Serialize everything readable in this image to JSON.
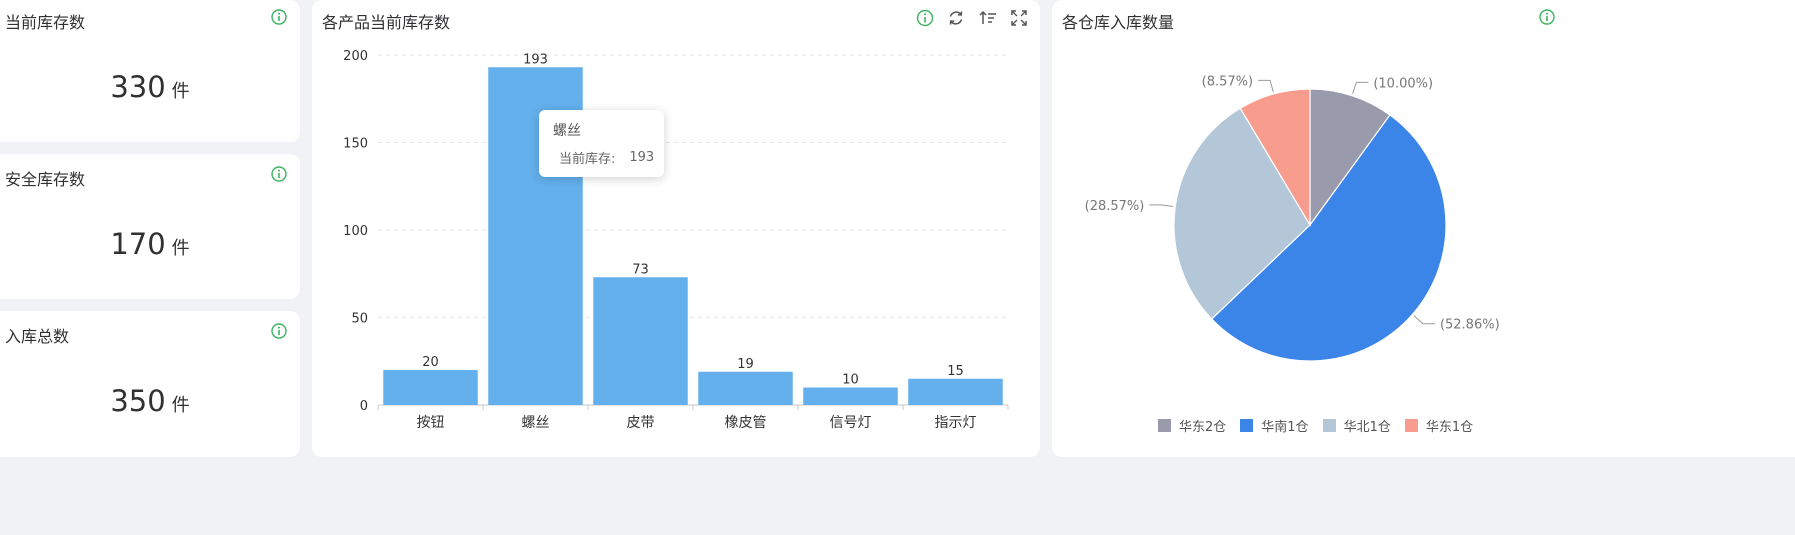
{
  "stats": [
    {
      "title": "当前库存数",
      "value": "330",
      "unit": "件"
    },
    {
      "title": "安全库存数",
      "value": "170",
      "unit": "件"
    },
    {
      "title": "入库总数",
      "value": "350",
      "unit": "件"
    }
  ],
  "bar_panel": {
    "title": "各产品当前库存数",
    "tooltip": {
      "category": "螺丝",
      "series_label": "当前库存:",
      "value": "193"
    }
  },
  "pie_panel": {
    "title": "各仓库入库数量"
  },
  "colors": {
    "bar": "#63b0ed",
    "info_icon": "#3cb35f",
    "pie": [
      "#9a9aad",
      "#3b84e8",
      "#b4c7d8",
      "#f89d8e"
    ]
  },
  "chart_data": [
    {
      "type": "bar",
      "title": "各产品当前库存数",
      "categories": [
        "按钮",
        "螺丝",
        "皮带",
        "橡皮管",
        "信号灯",
        "指示灯"
      ],
      "series": [
        {
          "name": "当前库存",
          "values": [
            20,
            193,
            73,
            19,
            10,
            15
          ]
        }
      ],
      "yticks": [
        "0",
        "50",
        "100",
        "150",
        "200"
      ],
      "ylim": [
        0,
        200
      ],
      "grid": true
    },
    {
      "type": "pie",
      "title": "各仓库入库数量",
      "labels": [
        "华东2仓",
        "华南1仓",
        "华北1仓",
        "华东1仓"
      ],
      "values": [
        10.0,
        52.86,
        28.57,
        8.57
      ],
      "slice_labels": [
        "(10.00%)",
        "(52.86%)",
        "(28.57%)",
        "(8.57%)"
      ],
      "legend_position": "bottom"
    }
  ]
}
